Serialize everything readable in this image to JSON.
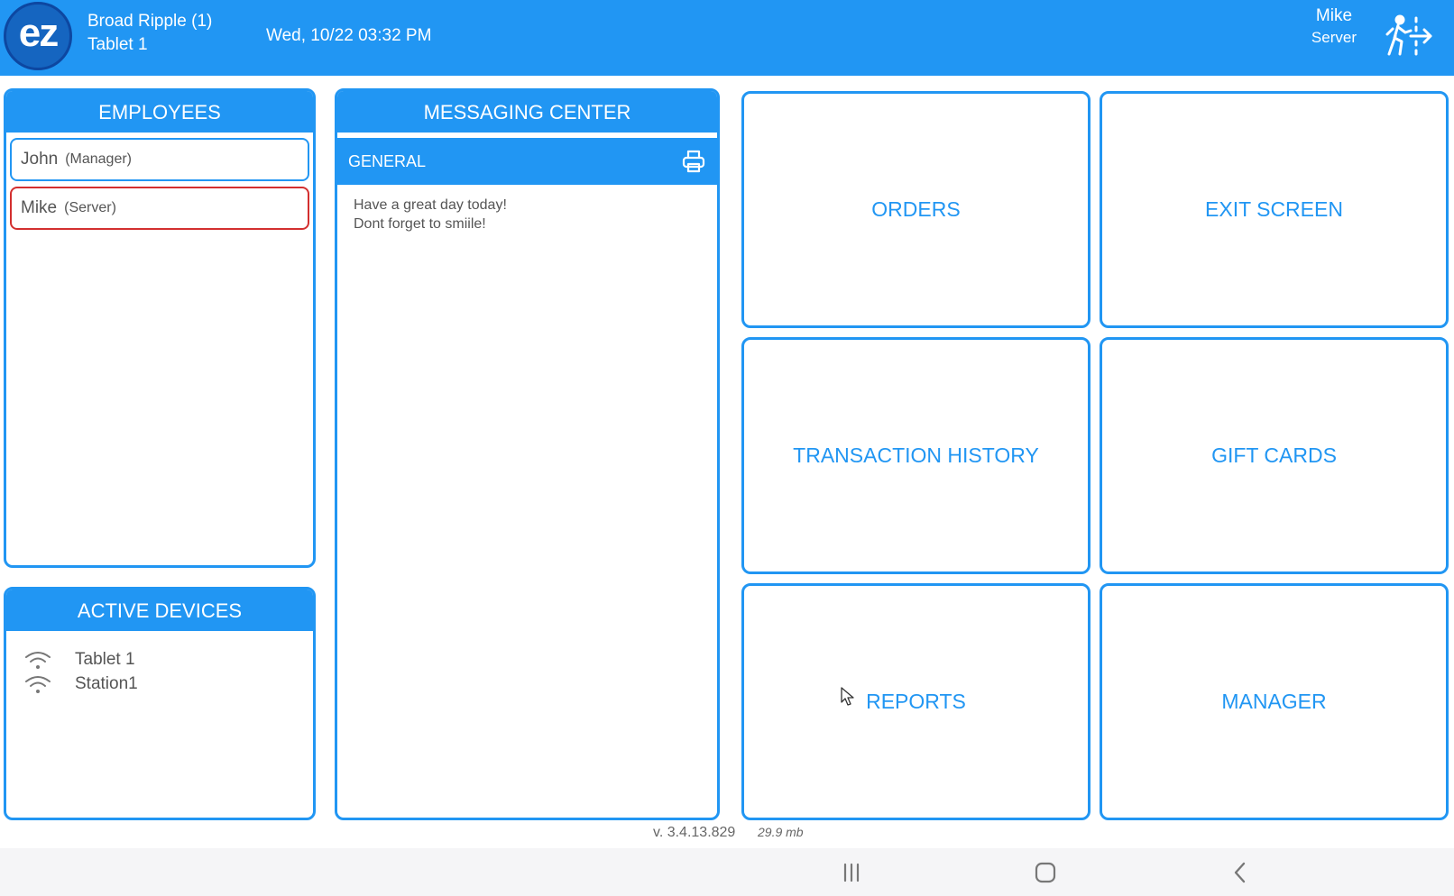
{
  "header": {
    "logo_text": "ez",
    "location": "Broad Ripple (1)",
    "device": "Tablet 1",
    "datetime": "Wed, 10/22 03:32 PM",
    "user_name": "Mike",
    "user_role": "Server",
    "exit_icon": "logout-person-icon",
    "color": "#2196f3"
  },
  "employees": {
    "title": "EMPLOYEES",
    "items": [
      {
        "name": "John",
        "role": "(Manager)"
      },
      {
        "name": "Mike",
        "role": "(Server)",
        "active_color": "#d32f2f"
      }
    ]
  },
  "active_devices": {
    "title": "ACTIVE DEVICES",
    "icon": "wifi-icon",
    "items": [
      "Tablet 1",
      "Station1"
    ]
  },
  "messaging": {
    "title": "MESSAGING CENTER",
    "channel": "GENERAL",
    "print_icon": "printer-icon",
    "lines": [
      "Have a great day today!",
      "Dont forget to smiile!"
    ]
  },
  "tiles": [
    "ORDERS",
    "EXIT SCREEN",
    "TRANSACTION HISTORY",
    "GIFT CARDS",
    "REPORTS",
    "MANAGER"
  ],
  "footer": {
    "version": "v. 3.4.13.829",
    "memory": "29.9  mb"
  },
  "navbar": {
    "icons": [
      "recents-icon",
      "home-icon",
      "back-icon"
    ]
  }
}
